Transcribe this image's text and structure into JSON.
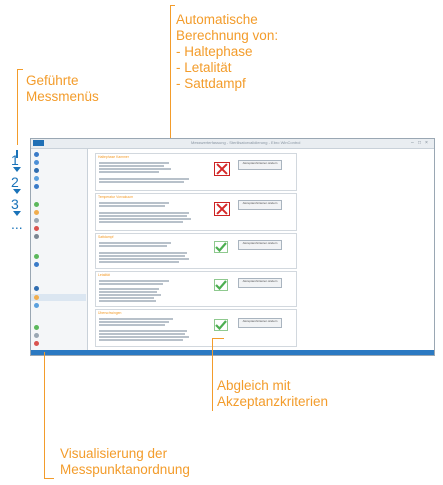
{
  "callouts": {
    "calc": [
      "Automatische",
      "Berechnung von:",
      "- Haltephase",
      "- Letalität",
      "- Sattdampf"
    ],
    "menus": [
      "Geführte",
      "Messmenüs"
    ],
    "accept": [
      "Abgleich mit",
      "Akzeptanzkriterien"
    ],
    "visual": [
      "Visualisierung der",
      "Messpunktanordnung"
    ]
  },
  "steps": [
    "1",
    "2",
    "3",
    "..."
  ],
  "window": {
    "title": "Messwerterfassung - Sterilisatorvalidierung - Ebro WinControl",
    "cards": [
      {
        "header": "Haltephase Kammer",
        "result": "fail",
        "button": "Akzeptanzkriterien ändern"
      },
      {
        "header": "Temperatur Vorvakuum",
        "result": "fail",
        "button": "Akzeptanzkriterien ändern"
      },
      {
        "header": "Sattdampf",
        "result": "pass",
        "button": "Akzeptanzkriterien ändern"
      },
      {
        "header": "Letalität",
        "result": "pass",
        "button": "Akzeptanzkriterien ändern"
      },
      {
        "header": "Überschwingen",
        "result": "pass",
        "button": "Akzeptanzkriterien ändern"
      }
    ]
  },
  "colors": {
    "accent": "#f39c2b",
    "blue": "#1a73b9",
    "pass": "#5cb85c",
    "fail": "#d62828"
  }
}
